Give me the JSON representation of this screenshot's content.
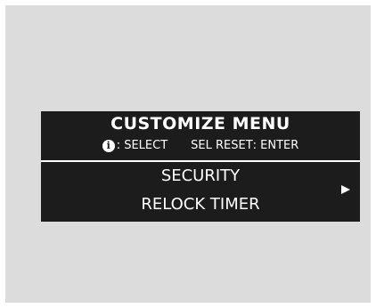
{
  "header": {
    "title": "CUSTOMIZE MENU",
    "info_icon_glyph": "i",
    "select_hint": ": SELECT",
    "reset_label": "SEL RESET",
    "enter_hint": ": ENTER"
  },
  "menu": {
    "item": {
      "line1": "SECURITY",
      "line2": "RELOCK TIMER"
    },
    "arrow_icon": "right-triangle-icon"
  },
  "colors": {
    "display_background": "#1c1c1c",
    "display_text": "#ffffff",
    "frame_background": "#dcdcdc"
  }
}
